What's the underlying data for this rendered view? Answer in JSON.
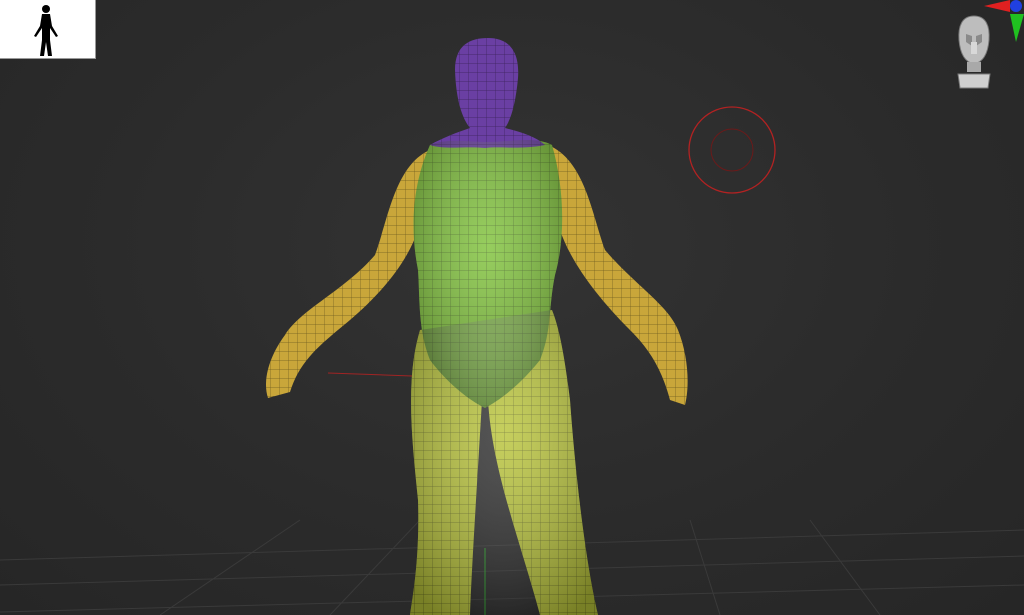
{
  "viewport": {
    "background": "#2b2b2b",
    "gridColor": "#3a3a3a"
  },
  "thumbnail": {
    "icon": "human-silhouette-icon",
    "background": "#ffffff"
  },
  "model": {
    "polygroupColors": {
      "head": "#6a3fa3",
      "torso": "#7fc23a",
      "arms": "#c9a63a",
      "legs": "#b9c43a"
    }
  },
  "brush": {
    "cursorColor": "#b22222"
  },
  "gizmo": {
    "icons": [
      "axis-gizmo-icon",
      "navigation-head-icon"
    ],
    "axisColors": {
      "x": "#e02020",
      "y": "#20c020",
      "z": "#2040e0"
    }
  }
}
